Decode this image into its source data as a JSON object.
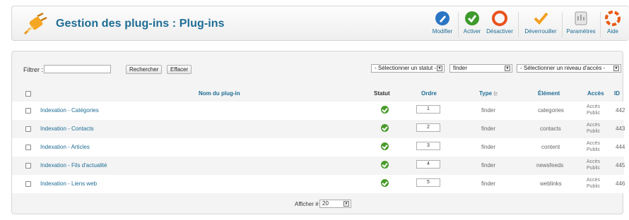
{
  "header": {
    "title": "Gestion des plug-ins : Plug-ins",
    "logo_icon": "plug-icon"
  },
  "toolbar": [
    {
      "label": "Modifier",
      "icon": "pencil-icon",
      "color": "#2b76c4"
    },
    {
      "label": "Activer",
      "icon": "check-circle-icon",
      "color": "#3d9a2c"
    },
    {
      "label": "Désactiver",
      "icon": "ring-icon",
      "color": "#e8521c"
    },
    {
      "label": "Déverrouiller",
      "icon": "unlock-check-icon",
      "color": "#f0a020"
    },
    {
      "label": "Paramètres",
      "icon": "settings-icon",
      "color": "#999999"
    },
    {
      "label": "Aide",
      "icon": "help-icon",
      "color": "#e85a10"
    }
  ],
  "filter": {
    "label": "Filtrer :",
    "value": "",
    "search_button": "Rechercher",
    "clear_button": "Effacer",
    "status_select": "- Sélectionner un statut -",
    "type_select": "finder",
    "access_select": "- Sélectionner un niveau d'accès -"
  },
  "columns": {
    "name": "Nom du plug-in",
    "status": "Statut",
    "order": "Ordre",
    "type": "Type",
    "element": "Élément",
    "access": "Accès",
    "id": "ID"
  },
  "rows": [
    {
      "name": "Indexation - Catégories",
      "order": "1",
      "type": "finder",
      "element": "categories",
      "access1": "Accès",
      "access2": "Public",
      "id": "442"
    },
    {
      "name": "Indexation - Contacts",
      "order": "2",
      "type": "finder",
      "element": "contacts",
      "access1": "Accès",
      "access2": "Public",
      "id": "443"
    },
    {
      "name": "Indexation - Articles",
      "order": "3",
      "type": "finder",
      "element": "content",
      "access1": "Accès",
      "access2": "Public",
      "id": "444"
    },
    {
      "name": "Indexation - Fils d'actualité",
      "order": "4",
      "type": "finder",
      "element": "newsfeeds",
      "access1": "Accès",
      "access2": "Public",
      "id": "445"
    },
    {
      "name": "Indexation - Liens web",
      "order": "5",
      "type": "finder",
      "element": "weblinks",
      "access1": "Accès",
      "access2": "Public",
      "id": "446"
    }
  ],
  "pagination": {
    "label": "Afficher #",
    "value": "20"
  }
}
